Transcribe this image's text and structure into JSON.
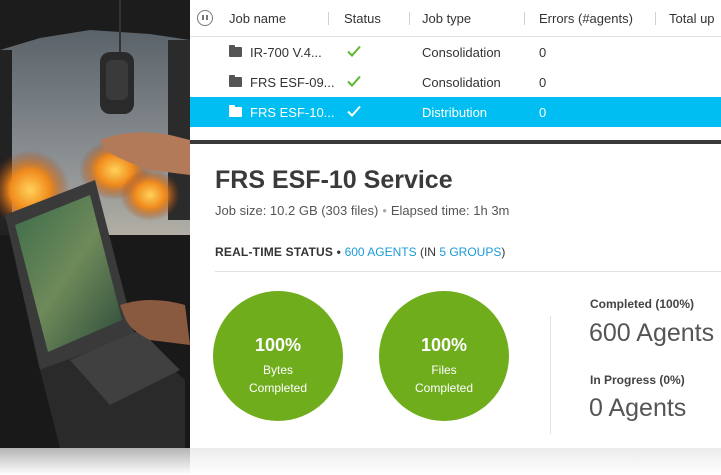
{
  "table": {
    "columns": [
      "Job name",
      "Status",
      "Job type",
      "Errors (#agents)",
      "Total up"
    ],
    "rows": [
      {
        "name": "IR-700 V.4...",
        "job_type": "Consolidation",
        "errors": "0",
        "selected": false
      },
      {
        "name": "FRS ESF-09...",
        "job_type": "Consolidation",
        "errors": "0",
        "selected": false
      },
      {
        "name": "FRS ESF-10...",
        "job_type": "Distribution",
        "errors": "0",
        "selected": true
      }
    ]
  },
  "detail": {
    "title": "FRS ESF-10 Service",
    "job_size": "Job size: 10.2 GB (303 files)",
    "elapsed": "Elapsed time: 1h 3m",
    "rt_label": "REAL-TIME STATUS",
    "rt_agents": "600 AGENTS",
    "rt_in_open": "(IN ",
    "rt_groups": "5 GROUPS",
    "rt_close": ")",
    "bytes": {
      "pct": "100%",
      "line1": "Bytes",
      "line2": "Completed",
      "value": 100
    },
    "files": {
      "pct": "100%",
      "line1": "Files",
      "line2": "Completed",
      "value": 100
    },
    "completed_label": "Completed (100%)",
    "completed_value": "600 Agents",
    "progress_label": "In Progress (0%)",
    "progress_value": "0 Agents"
  },
  "colors": {
    "accent": "#00bef2",
    "green": "#6fad1d",
    "check": "#5cb82e",
    "link": "#1a9bd7"
  },
  "icons": [
    "pause-icon",
    "folder-icon",
    "check-icon"
  ]
}
